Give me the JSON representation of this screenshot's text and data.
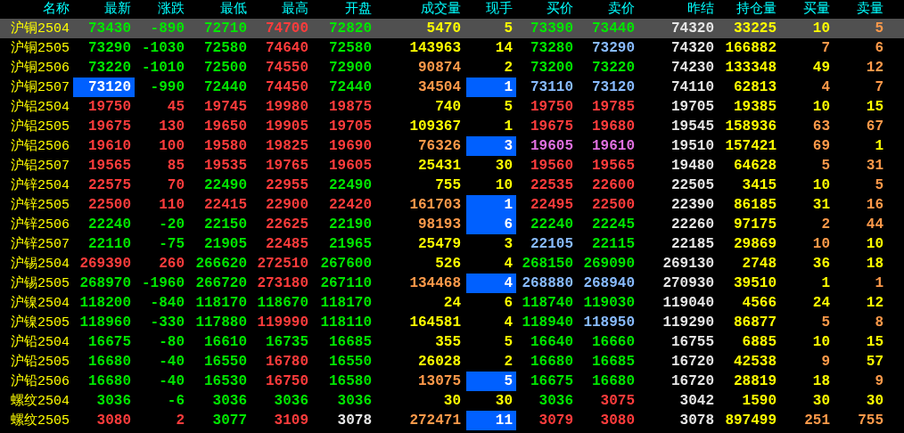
{
  "columns": [
    "名称",
    "最新",
    "涨跌",
    "最低",
    "最高",
    "开盘",
    "成交量",
    "现手",
    "买价",
    "卖价",
    "昨结",
    "持仓量",
    "买量",
    "卖量"
  ],
  "rows": [
    {
      "selected": true,
      "last_highlighted": false,
      "lot_highlighted": false,
      "cells": [
        {
          "text": "沪铜2504",
          "color": "#ffff00"
        },
        {
          "text": "73430",
          "color": "#00e600"
        },
        {
          "text": "-890",
          "color": "#00e600"
        },
        {
          "text": "72710",
          "color": "#00e600"
        },
        {
          "text": "74700",
          "color": "#ff3c3c"
        },
        {
          "text": "72820",
          "color": "#00e600"
        },
        {
          "text": "5470",
          "color": "#ffff00"
        },
        {
          "text": "5",
          "color": "#ffff00"
        },
        {
          "text": "73390",
          "color": "#00e600"
        },
        {
          "text": "73440",
          "color": "#00e600"
        },
        {
          "text": "74320",
          "color": "#e6e6e6"
        },
        {
          "text": "33225",
          "color": "#ffff00"
        },
        {
          "text": "10",
          "color": "#ffff00"
        },
        {
          "text": "5",
          "color": "#ff9a4a"
        }
      ]
    },
    {
      "selected": false,
      "last_highlighted": false,
      "lot_highlighted": false,
      "cells": [
        {
          "text": "沪铜2505",
          "color": "#ffff00"
        },
        {
          "text": "73290",
          "color": "#00e600"
        },
        {
          "text": "-1030",
          "color": "#00e600"
        },
        {
          "text": "72580",
          "color": "#00e600"
        },
        {
          "text": "74640",
          "color": "#ff3c3c"
        },
        {
          "text": "72580",
          "color": "#00e600"
        },
        {
          "text": "143963",
          "color": "#ffff00"
        },
        {
          "text": "14",
          "color": "#ffff00"
        },
        {
          "text": "73280",
          "color": "#00e600"
        },
        {
          "text": "73290",
          "color": "#88bbff"
        },
        {
          "text": "74320",
          "color": "#e6e6e6"
        },
        {
          "text": "166882",
          "color": "#ffff00"
        },
        {
          "text": "7",
          "color": "#ff9a4a"
        },
        {
          "text": "6",
          "color": "#ff9a4a"
        }
      ]
    },
    {
      "selected": false,
      "last_highlighted": false,
      "lot_highlighted": false,
      "cells": [
        {
          "text": "沪铜2506",
          "color": "#ffff00"
        },
        {
          "text": "73220",
          "color": "#00e600"
        },
        {
          "text": "-1010",
          "color": "#00e600"
        },
        {
          "text": "72500",
          "color": "#00e600"
        },
        {
          "text": "74550",
          "color": "#ff3c3c"
        },
        {
          "text": "72900",
          "color": "#00e600"
        },
        {
          "text": "90874",
          "color": "#ff9a4a"
        },
        {
          "text": "2",
          "color": "#ffff00"
        },
        {
          "text": "73200",
          "color": "#00e600"
        },
        {
          "text": "73220",
          "color": "#00e600"
        },
        {
          "text": "74230",
          "color": "#e6e6e6"
        },
        {
          "text": "133348",
          "color": "#ffff00"
        },
        {
          "text": "49",
          "color": "#ffff00"
        },
        {
          "text": "12",
          "color": "#ff9a4a"
        }
      ]
    },
    {
      "selected": false,
      "last_highlighted": true,
      "lot_highlighted": true,
      "cells": [
        {
          "text": "沪铜2507",
          "color": "#ffff00"
        },
        {
          "text": "73120",
          "color": "#ffffff"
        },
        {
          "text": "-990",
          "color": "#00e600"
        },
        {
          "text": "72440",
          "color": "#00e600"
        },
        {
          "text": "74450",
          "color": "#ff3c3c"
        },
        {
          "text": "72440",
          "color": "#00e600"
        },
        {
          "text": "34504",
          "color": "#ff9a4a"
        },
        {
          "text": "1",
          "color": "#ffffff"
        },
        {
          "text": "73110",
          "color": "#88bbff"
        },
        {
          "text": "73120",
          "color": "#88bbff"
        },
        {
          "text": "74110",
          "color": "#e6e6e6"
        },
        {
          "text": "62813",
          "color": "#ffff00"
        },
        {
          "text": "4",
          "color": "#ff9a4a"
        },
        {
          "text": "7",
          "color": "#ff9a4a"
        }
      ]
    },
    {
      "selected": false,
      "last_highlighted": false,
      "lot_highlighted": false,
      "cells": [
        {
          "text": "沪铝2504",
          "color": "#ffff00"
        },
        {
          "text": "19750",
          "color": "#ff3c3c"
        },
        {
          "text": "45",
          "color": "#ff3c3c"
        },
        {
          "text": "19745",
          "color": "#ff3c3c"
        },
        {
          "text": "19980",
          "color": "#ff3c3c"
        },
        {
          "text": "19875",
          "color": "#ff3c3c"
        },
        {
          "text": "740",
          "color": "#ffff00"
        },
        {
          "text": "5",
          "color": "#ffff00"
        },
        {
          "text": "19750",
          "color": "#ff3c3c"
        },
        {
          "text": "19785",
          "color": "#ff3c3c"
        },
        {
          "text": "19705",
          "color": "#e6e6e6"
        },
        {
          "text": "19385",
          "color": "#ffff00"
        },
        {
          "text": "10",
          "color": "#ffff00"
        },
        {
          "text": "15",
          "color": "#ffff00"
        }
      ]
    },
    {
      "selected": false,
      "last_highlighted": false,
      "lot_highlighted": false,
      "cells": [
        {
          "text": "沪铝2505",
          "color": "#ffff00"
        },
        {
          "text": "19675",
          "color": "#ff3c3c"
        },
        {
          "text": "130",
          "color": "#ff3c3c"
        },
        {
          "text": "19650",
          "color": "#ff3c3c"
        },
        {
          "text": "19905",
          "color": "#ff3c3c"
        },
        {
          "text": "19705",
          "color": "#ff3c3c"
        },
        {
          "text": "109367",
          "color": "#ffff00"
        },
        {
          "text": "1",
          "color": "#ffff00"
        },
        {
          "text": "19675",
          "color": "#ff3c3c"
        },
        {
          "text": "19680",
          "color": "#ff3c3c"
        },
        {
          "text": "19545",
          "color": "#e6e6e6"
        },
        {
          "text": "158936",
          "color": "#ffff00"
        },
        {
          "text": "63",
          "color": "#ff9a4a"
        },
        {
          "text": "67",
          "color": "#ff9a4a"
        }
      ]
    },
    {
      "selected": false,
      "last_highlighted": false,
      "lot_highlighted": true,
      "cells": [
        {
          "text": "沪铝2506",
          "color": "#ffff00"
        },
        {
          "text": "19610",
          "color": "#ff3c3c"
        },
        {
          "text": "100",
          "color": "#ff3c3c"
        },
        {
          "text": "19580",
          "color": "#ff3c3c"
        },
        {
          "text": "19825",
          "color": "#ff3c3c"
        },
        {
          "text": "19690",
          "color": "#ff3c3c"
        },
        {
          "text": "76326",
          "color": "#ff9a4a"
        },
        {
          "text": "3",
          "color": "#ffffff"
        },
        {
          "text": "19605",
          "color": "#e070e0"
        },
        {
          "text": "19610",
          "color": "#e070e0"
        },
        {
          "text": "19510",
          "color": "#e6e6e6"
        },
        {
          "text": "157421",
          "color": "#ffff00"
        },
        {
          "text": "69",
          "color": "#ff9a4a"
        },
        {
          "text": "1",
          "color": "#ffff00"
        }
      ]
    },
    {
      "selected": false,
      "last_highlighted": false,
      "lot_highlighted": false,
      "cells": [
        {
          "text": "沪铝2507",
          "color": "#ffff00"
        },
        {
          "text": "19565",
          "color": "#ff3c3c"
        },
        {
          "text": "85",
          "color": "#ff3c3c"
        },
        {
          "text": "19535",
          "color": "#ff3c3c"
        },
        {
          "text": "19765",
          "color": "#ff3c3c"
        },
        {
          "text": "19605",
          "color": "#ff3c3c"
        },
        {
          "text": "25431",
          "color": "#ffff00"
        },
        {
          "text": "30",
          "color": "#ffff00"
        },
        {
          "text": "19560",
          "color": "#ff3c3c"
        },
        {
          "text": "19565",
          "color": "#ff3c3c"
        },
        {
          "text": "19480",
          "color": "#e6e6e6"
        },
        {
          "text": "64628",
          "color": "#ffff00"
        },
        {
          "text": "5",
          "color": "#ff9a4a"
        },
        {
          "text": "31",
          "color": "#ff9a4a"
        }
      ]
    },
    {
      "selected": false,
      "last_highlighted": false,
      "lot_highlighted": false,
      "cells": [
        {
          "text": "沪锌2504",
          "color": "#ffff00"
        },
        {
          "text": "22575",
          "color": "#ff3c3c"
        },
        {
          "text": "70",
          "color": "#ff3c3c"
        },
        {
          "text": "22490",
          "color": "#00e600"
        },
        {
          "text": "22955",
          "color": "#ff3c3c"
        },
        {
          "text": "22490",
          "color": "#00e600"
        },
        {
          "text": "755",
          "color": "#ffff00"
        },
        {
          "text": "10",
          "color": "#ffff00"
        },
        {
          "text": "22535",
          "color": "#ff3c3c"
        },
        {
          "text": "22600",
          "color": "#ff3c3c"
        },
        {
          "text": "22505",
          "color": "#e6e6e6"
        },
        {
          "text": "3415",
          "color": "#ffff00"
        },
        {
          "text": "10",
          "color": "#ffff00"
        },
        {
          "text": "5",
          "color": "#ff9a4a"
        }
      ]
    },
    {
      "selected": false,
      "last_highlighted": false,
      "lot_highlighted": true,
      "cells": [
        {
          "text": "沪锌2505",
          "color": "#ffff00"
        },
        {
          "text": "22500",
          "color": "#ff3c3c"
        },
        {
          "text": "110",
          "color": "#ff3c3c"
        },
        {
          "text": "22415",
          "color": "#ff3c3c"
        },
        {
          "text": "22900",
          "color": "#ff3c3c"
        },
        {
          "text": "22420",
          "color": "#ff3c3c"
        },
        {
          "text": "161703",
          "color": "#ff9a4a"
        },
        {
          "text": "1",
          "color": "#ffffff"
        },
        {
          "text": "22495",
          "color": "#ff3c3c"
        },
        {
          "text": "22500",
          "color": "#ff3c3c"
        },
        {
          "text": "22390",
          "color": "#e6e6e6"
        },
        {
          "text": "86185",
          "color": "#ffff00"
        },
        {
          "text": "31",
          "color": "#ffff00"
        },
        {
          "text": "16",
          "color": "#ff9a4a"
        }
      ]
    },
    {
      "selected": false,
      "last_highlighted": false,
      "lot_highlighted": true,
      "cells": [
        {
          "text": "沪锌2506",
          "color": "#ffff00"
        },
        {
          "text": "22240",
          "color": "#00e600"
        },
        {
          "text": "-20",
          "color": "#00e600"
        },
        {
          "text": "22150",
          "color": "#00e600"
        },
        {
          "text": "22625",
          "color": "#ff3c3c"
        },
        {
          "text": "22190",
          "color": "#00e600"
        },
        {
          "text": "98193",
          "color": "#ff9a4a"
        },
        {
          "text": "6",
          "color": "#ffffff"
        },
        {
          "text": "22240",
          "color": "#00e600"
        },
        {
          "text": "22245",
          "color": "#00e600"
        },
        {
          "text": "22260",
          "color": "#e6e6e6"
        },
        {
          "text": "97175",
          "color": "#ffff00"
        },
        {
          "text": "2",
          "color": "#ff9a4a"
        },
        {
          "text": "44",
          "color": "#ff9a4a"
        }
      ]
    },
    {
      "selected": false,
      "last_highlighted": false,
      "lot_highlighted": false,
      "cells": [
        {
          "text": "沪锌2507",
          "color": "#ffff00"
        },
        {
          "text": "22110",
          "color": "#00e600"
        },
        {
          "text": "-75",
          "color": "#00e600"
        },
        {
          "text": "21905",
          "color": "#00e600"
        },
        {
          "text": "22485",
          "color": "#ff3c3c"
        },
        {
          "text": "21965",
          "color": "#00e600"
        },
        {
          "text": "25479",
          "color": "#ffff00"
        },
        {
          "text": "3",
          "color": "#ffff00"
        },
        {
          "text": "22105",
          "color": "#88bbff"
        },
        {
          "text": "22115",
          "color": "#00e600"
        },
        {
          "text": "22185",
          "color": "#e6e6e6"
        },
        {
          "text": "29869",
          "color": "#ffff00"
        },
        {
          "text": "10",
          "color": "#ff9a4a"
        },
        {
          "text": "10",
          "color": "#ffff00"
        }
      ]
    },
    {
      "selected": false,
      "last_highlighted": false,
      "lot_highlighted": false,
      "cells": [
        {
          "text": "沪锡2504",
          "color": "#ffff00"
        },
        {
          "text": "269390",
          "color": "#ff3c3c"
        },
        {
          "text": "260",
          "color": "#ff3c3c"
        },
        {
          "text": "266620",
          "color": "#00e600"
        },
        {
          "text": "272510",
          "color": "#ff3c3c"
        },
        {
          "text": "267600",
          "color": "#00e600"
        },
        {
          "text": "526",
          "color": "#ffff00"
        },
        {
          "text": "4",
          "color": "#ffff00"
        },
        {
          "text": "268150",
          "color": "#00e600"
        },
        {
          "text": "269090",
          "color": "#00e600"
        },
        {
          "text": "269130",
          "color": "#e6e6e6"
        },
        {
          "text": "2748",
          "color": "#ffff00"
        },
        {
          "text": "36",
          "color": "#ffff00"
        },
        {
          "text": "18",
          "color": "#ffff00"
        }
      ]
    },
    {
      "selected": false,
      "last_highlighted": false,
      "lot_highlighted": true,
      "cells": [
        {
          "text": "沪锡2505",
          "color": "#ffff00"
        },
        {
          "text": "268970",
          "color": "#00e600"
        },
        {
          "text": "-1960",
          "color": "#00e600"
        },
        {
          "text": "266720",
          "color": "#00e600"
        },
        {
          "text": "273180",
          "color": "#ff3c3c"
        },
        {
          "text": "267110",
          "color": "#00e600"
        },
        {
          "text": "134468",
          "color": "#ff9a4a"
        },
        {
          "text": "4",
          "color": "#ffffff"
        },
        {
          "text": "268880",
          "color": "#88bbff"
        },
        {
          "text": "268940",
          "color": "#88bbff"
        },
        {
          "text": "270930",
          "color": "#e6e6e6"
        },
        {
          "text": "39510",
          "color": "#ffff00"
        },
        {
          "text": "1",
          "color": "#ffff00"
        },
        {
          "text": "1",
          "color": "#ff9a4a"
        }
      ]
    },
    {
      "selected": false,
      "last_highlighted": false,
      "lot_highlighted": false,
      "cells": [
        {
          "text": "沪镍2504",
          "color": "#ffff00"
        },
        {
          "text": "118200",
          "color": "#00e600"
        },
        {
          "text": "-840",
          "color": "#00e600"
        },
        {
          "text": "118170",
          "color": "#00e600"
        },
        {
          "text": "118670",
          "color": "#00e600"
        },
        {
          "text": "118170",
          "color": "#00e600"
        },
        {
          "text": "24",
          "color": "#ffff00"
        },
        {
          "text": "6",
          "color": "#ffff00"
        },
        {
          "text": "118740",
          "color": "#00e600"
        },
        {
          "text": "119030",
          "color": "#00e600"
        },
        {
          "text": "119040",
          "color": "#e6e6e6"
        },
        {
          "text": "4566",
          "color": "#ffff00"
        },
        {
          "text": "24",
          "color": "#ffff00"
        },
        {
          "text": "12",
          "color": "#ffff00"
        }
      ]
    },
    {
      "selected": false,
      "last_highlighted": false,
      "lot_highlighted": false,
      "cells": [
        {
          "text": "沪镍2505",
          "color": "#ffff00"
        },
        {
          "text": "118960",
          "color": "#00e600"
        },
        {
          "text": "-330",
          "color": "#00e600"
        },
        {
          "text": "117880",
          "color": "#00e600"
        },
        {
          "text": "119990",
          "color": "#ff3c3c"
        },
        {
          "text": "118110",
          "color": "#00e600"
        },
        {
          "text": "164581",
          "color": "#ffff00"
        },
        {
          "text": "4",
          "color": "#ffff00"
        },
        {
          "text": "118940",
          "color": "#00e600"
        },
        {
          "text": "118950",
          "color": "#88bbff"
        },
        {
          "text": "119290",
          "color": "#e6e6e6"
        },
        {
          "text": "86877",
          "color": "#ffff00"
        },
        {
          "text": "5",
          "color": "#ff9a4a"
        },
        {
          "text": "8",
          "color": "#ff9a4a"
        }
      ]
    },
    {
      "selected": false,
      "last_highlighted": false,
      "lot_highlighted": false,
      "cells": [
        {
          "text": "沪铅2504",
          "color": "#ffff00"
        },
        {
          "text": "16675",
          "color": "#00e600"
        },
        {
          "text": "-80",
          "color": "#00e600"
        },
        {
          "text": "16610",
          "color": "#00e600"
        },
        {
          "text": "16735",
          "color": "#00e600"
        },
        {
          "text": "16685",
          "color": "#00e600"
        },
        {
          "text": "355",
          "color": "#ffff00"
        },
        {
          "text": "5",
          "color": "#ffff00"
        },
        {
          "text": "16640",
          "color": "#00e600"
        },
        {
          "text": "16660",
          "color": "#00e600"
        },
        {
          "text": "16755",
          "color": "#e6e6e6"
        },
        {
          "text": "6885",
          "color": "#ffff00"
        },
        {
          "text": "10",
          "color": "#ffff00"
        },
        {
          "text": "15",
          "color": "#ffff00"
        }
      ]
    },
    {
      "selected": false,
      "last_highlighted": false,
      "lot_highlighted": false,
      "cells": [
        {
          "text": "沪铅2505",
          "color": "#ffff00"
        },
        {
          "text": "16680",
          "color": "#00e600"
        },
        {
          "text": "-40",
          "color": "#00e600"
        },
        {
          "text": "16550",
          "color": "#00e600"
        },
        {
          "text": "16780",
          "color": "#ff3c3c"
        },
        {
          "text": "16550",
          "color": "#00e600"
        },
        {
          "text": "26028",
          "color": "#ffff00"
        },
        {
          "text": "2",
          "color": "#ffff00"
        },
        {
          "text": "16680",
          "color": "#00e600"
        },
        {
          "text": "16685",
          "color": "#00e600"
        },
        {
          "text": "16720",
          "color": "#e6e6e6"
        },
        {
          "text": "42538",
          "color": "#ffff00"
        },
        {
          "text": "9",
          "color": "#ff9a4a"
        },
        {
          "text": "57",
          "color": "#ffff00"
        }
      ]
    },
    {
      "selected": false,
      "last_highlighted": false,
      "lot_highlighted": true,
      "cells": [
        {
          "text": "沪铅2506",
          "color": "#ffff00"
        },
        {
          "text": "16680",
          "color": "#00e600"
        },
        {
          "text": "-40",
          "color": "#00e600"
        },
        {
          "text": "16530",
          "color": "#00e600"
        },
        {
          "text": "16750",
          "color": "#ff3c3c"
        },
        {
          "text": "16580",
          "color": "#00e600"
        },
        {
          "text": "13075",
          "color": "#ff9a4a"
        },
        {
          "text": "5",
          "color": "#ffffff"
        },
        {
          "text": "16675",
          "color": "#00e600"
        },
        {
          "text": "16680",
          "color": "#00e600"
        },
        {
          "text": "16720",
          "color": "#e6e6e6"
        },
        {
          "text": "28819",
          "color": "#ffff00"
        },
        {
          "text": "18",
          "color": "#ffff00"
        },
        {
          "text": "9",
          "color": "#ff9a4a"
        }
      ]
    },
    {
      "selected": false,
      "last_highlighted": false,
      "lot_highlighted": false,
      "cells": [
        {
          "text": "螺纹2504",
          "color": "#ffff00"
        },
        {
          "text": "3036",
          "color": "#00e600"
        },
        {
          "text": "-6",
          "color": "#00e600"
        },
        {
          "text": "3036",
          "color": "#00e600"
        },
        {
          "text": "3036",
          "color": "#00e600"
        },
        {
          "text": "3036",
          "color": "#00e600"
        },
        {
          "text": "30",
          "color": "#ffff00"
        },
        {
          "text": "30",
          "color": "#ffff00"
        },
        {
          "text": "3036",
          "color": "#00e600"
        },
        {
          "text": "3075",
          "color": "#ff3c3c"
        },
        {
          "text": "3042",
          "color": "#e6e6e6"
        },
        {
          "text": "1590",
          "color": "#ffff00"
        },
        {
          "text": "30",
          "color": "#ffff00"
        },
        {
          "text": "30",
          "color": "#ffff00"
        }
      ]
    },
    {
      "selected": false,
      "last_highlighted": false,
      "lot_highlighted": true,
      "cells": [
        {
          "text": "螺纹2505",
          "color": "#ffff00"
        },
        {
          "text": "3080",
          "color": "#ff3c3c"
        },
        {
          "text": "2",
          "color": "#ff3c3c"
        },
        {
          "text": "3077",
          "color": "#00e600"
        },
        {
          "text": "3109",
          "color": "#ff3c3c"
        },
        {
          "text": "3078",
          "color": "#e6e6e6"
        },
        {
          "text": "272471",
          "color": "#ff9a4a"
        },
        {
          "text": "11",
          "color": "#ffffff"
        },
        {
          "text": "3079",
          "color": "#ff3c3c"
        },
        {
          "text": "3080",
          "color": "#ff3c3c"
        },
        {
          "text": "3078",
          "color": "#e6e6e6"
        },
        {
          "text": "897499",
          "color": "#ffff00"
        },
        {
          "text": "251",
          "color": "#ff9a4a"
        },
        {
          "text": "755",
          "color": "#ff9a4a"
        }
      ]
    }
  ]
}
